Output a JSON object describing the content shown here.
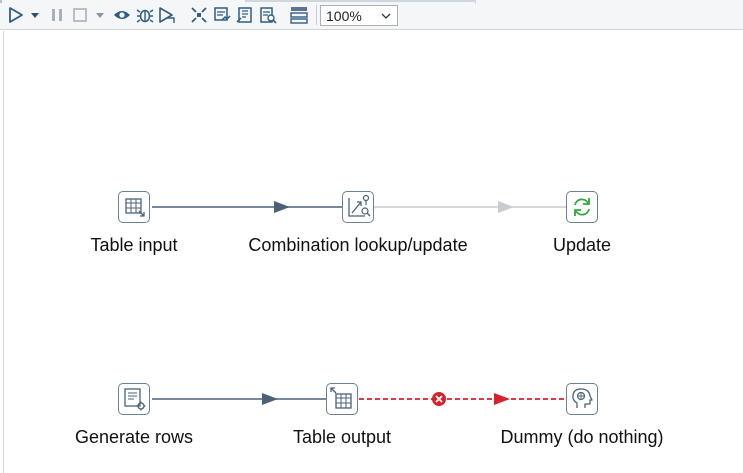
{
  "toolbar": {
    "zoom": "100%",
    "icons": [
      "run-icon",
      "run-dropdown-icon",
      "pause-icon",
      "stop-icon",
      "stop-dropdown-icon",
      "preview-icon",
      "debug-icon",
      "replay-icon",
      "verify-icon",
      "impact-analysis-icon",
      "sql-icon",
      "explore-db-icon",
      "show-results-icon"
    ]
  },
  "steps": {
    "table_input": "Table input",
    "combination_lookup": "Combination lookup/update",
    "update": "Update",
    "generate_rows": "Generate rows",
    "table_output": "Table output",
    "dummy": "Dummy (do nothing)"
  },
  "hops": {
    "enabled_color": "#4a6278",
    "disabled_color": "#c8ccd0",
    "error_color": "#d6212f"
  }
}
